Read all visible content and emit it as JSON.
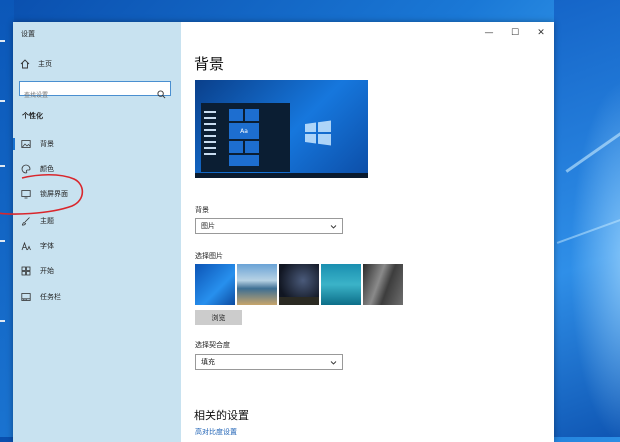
{
  "window": {
    "title": "设置",
    "controls": [
      "—",
      "☐",
      "✕"
    ]
  },
  "sidebar": {
    "home_label": "主页",
    "search_placeholder": "查找设置",
    "section_title": "个性化",
    "items": [
      {
        "label": "背景",
        "icon": "image-icon",
        "selected": true
      },
      {
        "label": "颜色",
        "icon": "palette-icon",
        "selected": false
      },
      {
        "label": "锁屏界面",
        "icon": "lock-screen-icon",
        "selected": false
      },
      {
        "label": "主题",
        "icon": "brush-icon",
        "selected": false
      },
      {
        "label": "字体",
        "icon": "font-icon",
        "selected": false
      },
      {
        "label": "开始",
        "icon": "start-icon",
        "selected": false
      },
      {
        "label": "任务栏",
        "icon": "taskbar-icon",
        "selected": false
      }
    ]
  },
  "main": {
    "page_title": "背景",
    "preview_tile_text": "Aa",
    "background_label": "背景",
    "background_value": "图片",
    "choose_picture_label": "选择图片",
    "browse_label": "浏览",
    "fit_label": "选择契合度",
    "fit_value": "填充",
    "related_title": "相关的设置",
    "related_link": "高对比度设置"
  },
  "colors": {
    "accent": "#1a73d0",
    "sidebar_bg": "#c8e2f0",
    "annotation": "#d9262c"
  }
}
